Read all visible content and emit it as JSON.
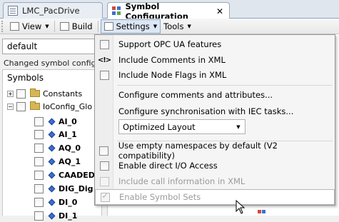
{
  "tabs": [
    {
      "label": "LMC_PacDrive",
      "active": false
    },
    {
      "label": "Symbol Configuration",
      "active": true
    }
  ],
  "toolbar": {
    "view_label": "View",
    "build_label": "Build",
    "settings_label": "Settings",
    "tools_label": "Tools"
  },
  "left": {
    "combo_value": "default",
    "status": "Changed symbol configurati",
    "tree_header": "Symbols",
    "items": [
      {
        "label": "Constants",
        "type": "folder"
      },
      {
        "label": "IoConfig_Glo",
        "type": "folder"
      },
      {
        "label": "AI_0",
        "type": "var"
      },
      {
        "label": "AI_1",
        "type": "var"
      },
      {
        "label": "AQ_0",
        "type": "var"
      },
      {
        "label": "AQ_1",
        "type": "var"
      },
      {
        "label": "CAADEDT",
        "type": "var"
      },
      {
        "label": "DIG_Dig",
        "type": "var"
      },
      {
        "label": "DI_0",
        "type": "var"
      },
      {
        "label": "DI_1",
        "type": "var"
      }
    ]
  },
  "menu": {
    "items": [
      {
        "label": "Support OPC UA features",
        "kind": "check",
        "checked": false,
        "disabled": false
      },
      {
        "label": "Include Comments in XML",
        "kind": "icon",
        "icon": "xml-comment-icon",
        "disabled": false
      },
      {
        "label": "Include Node Flags in XML",
        "kind": "check",
        "checked": false,
        "disabled": false
      },
      {
        "label": "Configure comments and attributes...",
        "kind": "plain",
        "disabled": false
      },
      {
        "label": "Configure synchronisation with IEC tasks...",
        "kind": "plain",
        "disabled": false
      },
      {
        "label": "Optimized Layout",
        "kind": "select",
        "disabled": false
      },
      {
        "label": "Use empty namespaces by default (V2 compatibility)",
        "kind": "check",
        "checked": false,
        "disabled": false
      },
      {
        "label": "Enable direct I/O Access",
        "kind": "check",
        "checked": false,
        "disabled": false
      },
      {
        "label": "Include call information in XML",
        "kind": "check",
        "checked": false,
        "disabled": true
      },
      {
        "label": "Enable Symbol Sets",
        "kind": "check",
        "checked": true,
        "disabled": true
      }
    ],
    "xml_icon_glyph": "<!>"
  },
  "colors": {
    "tab_bar": "#dfe6ee",
    "menu_bg": "#f5f5f5",
    "variable_icon": "#3a6fd1"
  }
}
